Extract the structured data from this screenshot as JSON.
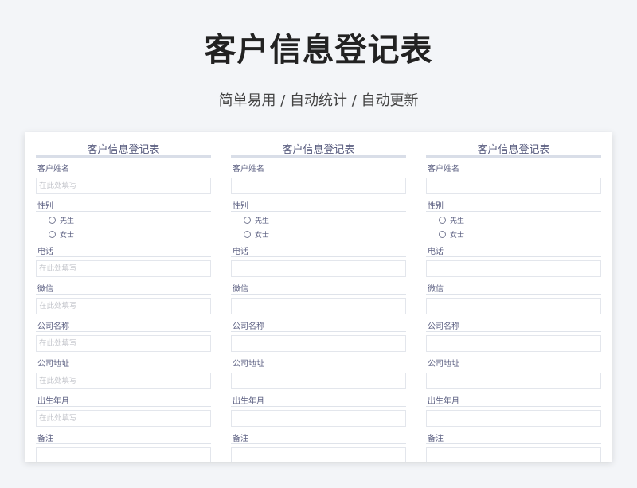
{
  "header": {
    "title": "客户信息登记表",
    "subtitle": "简单易用  /  自动统计  /  自动更新"
  },
  "form": {
    "title": "客户信息登记表",
    "placeholder": "在此处填写",
    "fields": {
      "name": "客户姓名",
      "gender": "性别",
      "phone": "电话",
      "wechat": "微信",
      "company": "公司名称",
      "address": "公司地址",
      "birth": "出生年月",
      "notes": "备注"
    },
    "gender_options": [
      "先生",
      "女士"
    ]
  },
  "colors": {
    "background": "#f3f5f8",
    "label": "#5a5e80",
    "placeholder": "#c4c6cc",
    "rule": "#d9dee8"
  }
}
